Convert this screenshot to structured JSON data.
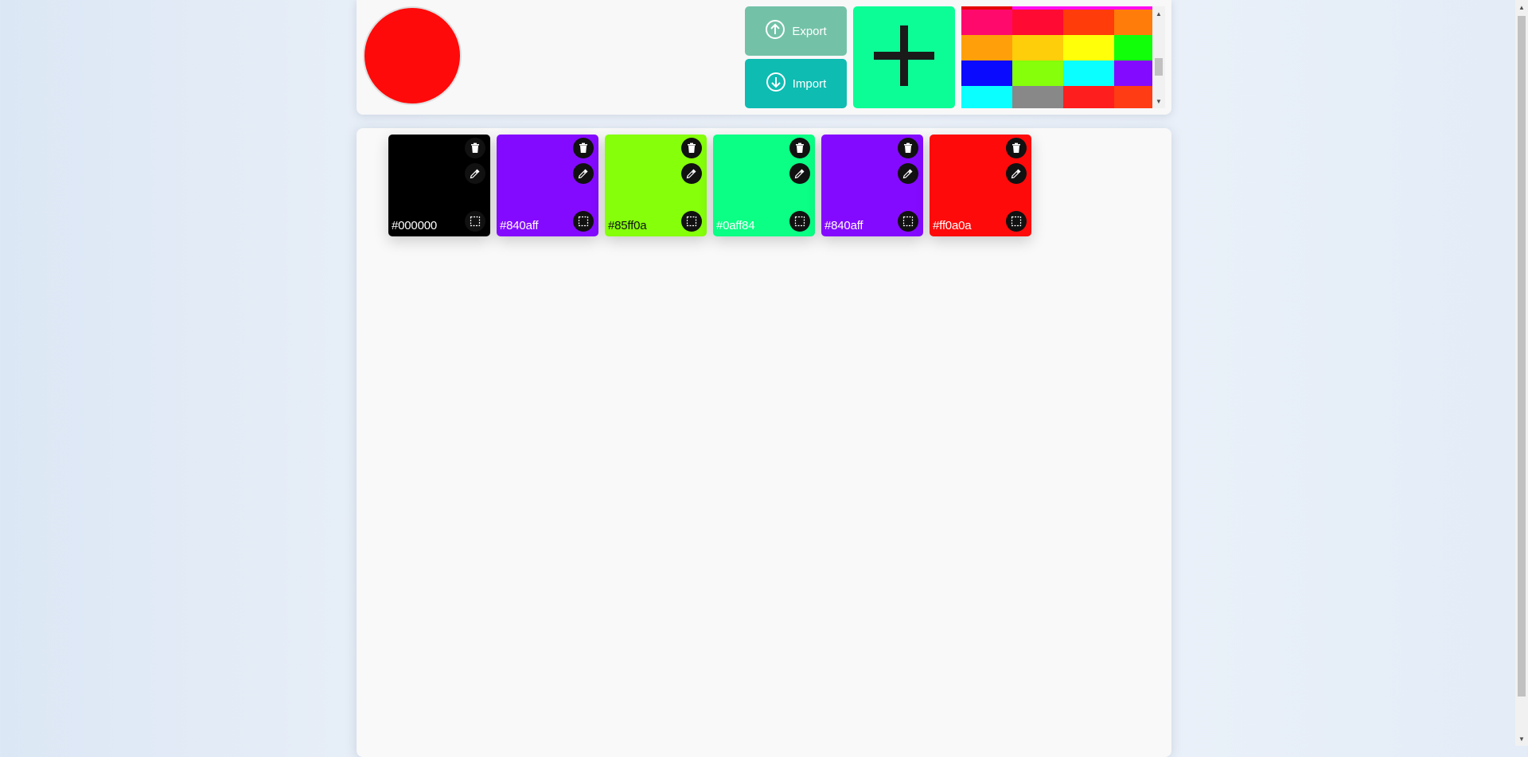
{
  "header": {
    "current_color": "#ff0a0a",
    "export_label": "Export",
    "import_label": "Import",
    "export_icon": "arrow-up-circle-icon",
    "import_icon": "arrow-down-circle-icon",
    "add_icon": "plus-icon",
    "palette": [
      "#ff0a6c",
      "#ff0a32",
      "#ff3c0a",
      "#ff7b0a",
      "#ff9f0a",
      "#ffce0a",
      "#ffff0a",
      "#12ff0a",
      "#0a0aff",
      "#85ff0a",
      "#0affff",
      "#840aff",
      "#0affff",
      "#888888",
      "#ff1e1e",
      "#ff3c14"
    ]
  },
  "colors": [
    {
      "hex": "#000000",
      "label": "#000000",
      "text": "light"
    },
    {
      "hex": "#840aff",
      "label": "#840aff",
      "text": "light"
    },
    {
      "hex": "#85ff0a",
      "label": "#85ff0a",
      "text": "dark"
    },
    {
      "hex": "#0aff84",
      "label": "#0aff84",
      "text": "light"
    },
    {
      "hex": "#840aff",
      "label": "#840aff",
      "text": "light"
    },
    {
      "hex": "#ff0a0a",
      "label": "#ff0a0a",
      "text": "light"
    }
  ],
  "card_icons": {
    "delete": "trash-icon",
    "pick": "eyedropper-icon",
    "select": "select-area-icon"
  }
}
